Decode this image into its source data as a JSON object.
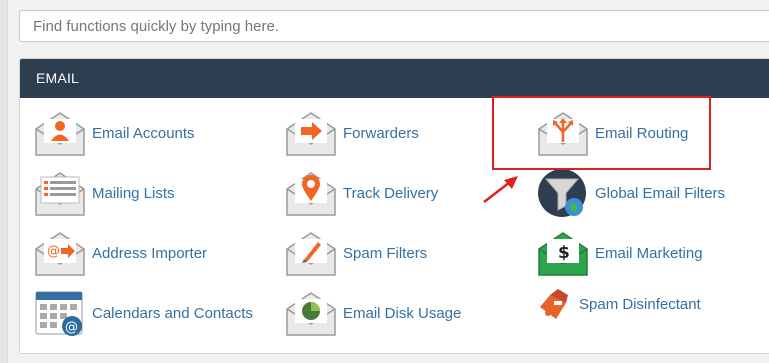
{
  "search": {
    "placeholder": "Find functions quickly by typing here."
  },
  "section": {
    "title": "EMAIL",
    "items": [
      {
        "label": "Email Accounts",
        "icon": "email-accounts-icon"
      },
      {
        "label": "Forwarders",
        "icon": "forwarders-icon"
      },
      {
        "label": "Email Routing",
        "icon": "email-routing-icon"
      },
      {
        "label": "Mailing Lists",
        "icon": "mailing-lists-icon"
      },
      {
        "label": "Track Delivery",
        "icon": "track-delivery-icon"
      },
      {
        "label": "Global Email Filters",
        "icon": "global-email-filters-icon"
      },
      {
        "label": "Address Importer",
        "icon": "address-importer-icon"
      },
      {
        "label": "Spam Filters",
        "icon": "spam-filters-icon"
      },
      {
        "label": "Email Marketing",
        "icon": "email-marketing-icon"
      },
      {
        "label": "Calendars and Contacts",
        "icon": "calendars-contacts-icon"
      },
      {
        "label": "Email Disk Usage",
        "icon": "email-disk-usage-icon"
      },
      {
        "label": "Spam Disinfectant",
        "icon": "spam-disinfectant-icon"
      }
    ]
  },
  "colors": {
    "header": "#2c3e50",
    "link": "#3470a3",
    "accent": "#f26522",
    "annotation": "#e01f1f"
  }
}
